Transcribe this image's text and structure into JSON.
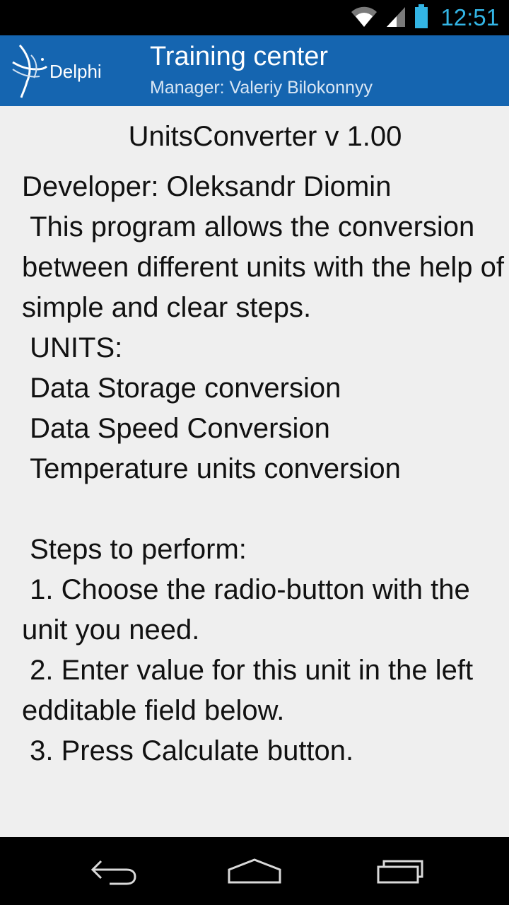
{
  "status_bar": {
    "time": "12:51",
    "icons": [
      "wifi-icon",
      "cell-signal-icon",
      "battery-icon"
    ],
    "accent_color": "#33b5e5"
  },
  "action_bar": {
    "logo_text": "Delphi",
    "title": "Training center",
    "subtitle": "Manager: Valeriy Bilokonnyy",
    "background_color": "#1565b0"
  },
  "content": {
    "app_title": "UnitsConverter v 1.00",
    "about_text": "Developer: Oleksandr Diomin\n This program allows the conversion between different units with the help of simple and clear steps.\n UNITS:\n Data Storage conversion\n Data Speed Conversion\n Temperature units conversion\n\n Steps to perform:\n 1. Choose the radio-button with the unit you need.\n 2. Enter value for this unit in the left edditable field below.\n 3. Press Calculate button."
  },
  "nav_bar": {
    "buttons": [
      "back-icon",
      "home-icon",
      "recent-apps-icon"
    ]
  }
}
